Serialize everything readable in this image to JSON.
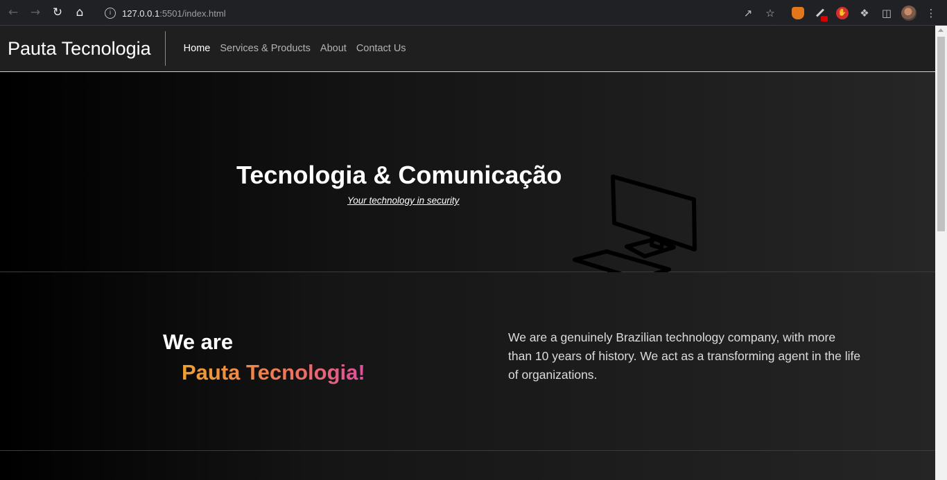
{
  "browser": {
    "url_host": "127.0.0.1",
    "url_rest": ":5501/index.html",
    "icons": [
      "back-icon",
      "forward-icon",
      "reload-icon",
      "home-icon",
      "info-icon",
      "share-icon",
      "bookmark-star-icon",
      "metamask-extension-icon",
      "pen-extension-icon",
      "stop-extension-icon",
      "extensions-puzzle-icon",
      "side-panel-icon",
      "profile-avatar",
      "menu-kebab-icon"
    ]
  },
  "navbar": {
    "brand": "Pauta Tecnologia",
    "links": [
      {
        "label": "Home",
        "active": true
      },
      {
        "label": "Services & Products",
        "active": false
      },
      {
        "label": "About",
        "active": false
      },
      {
        "label": "Contact Us",
        "active": false
      }
    ]
  },
  "hero": {
    "title": "Tecnologia & Comunicação",
    "subtitle": "Your technology in security",
    "icon": "computer-icon"
  },
  "about": {
    "heading": "We are",
    "brand_highlight": "Pauta Tecnologia!",
    "description": "We are a genuinely Brazilian technology company, with more than 10 years of history. We act as a transforming agent in the life of organizations."
  },
  "colors": {
    "highlight_gradient": [
      "#f0a030",
      "#ee7a56",
      "#dd4f9e"
    ],
    "navbar_bg": "#1f1f1f",
    "chrome_bg": "#202124"
  }
}
